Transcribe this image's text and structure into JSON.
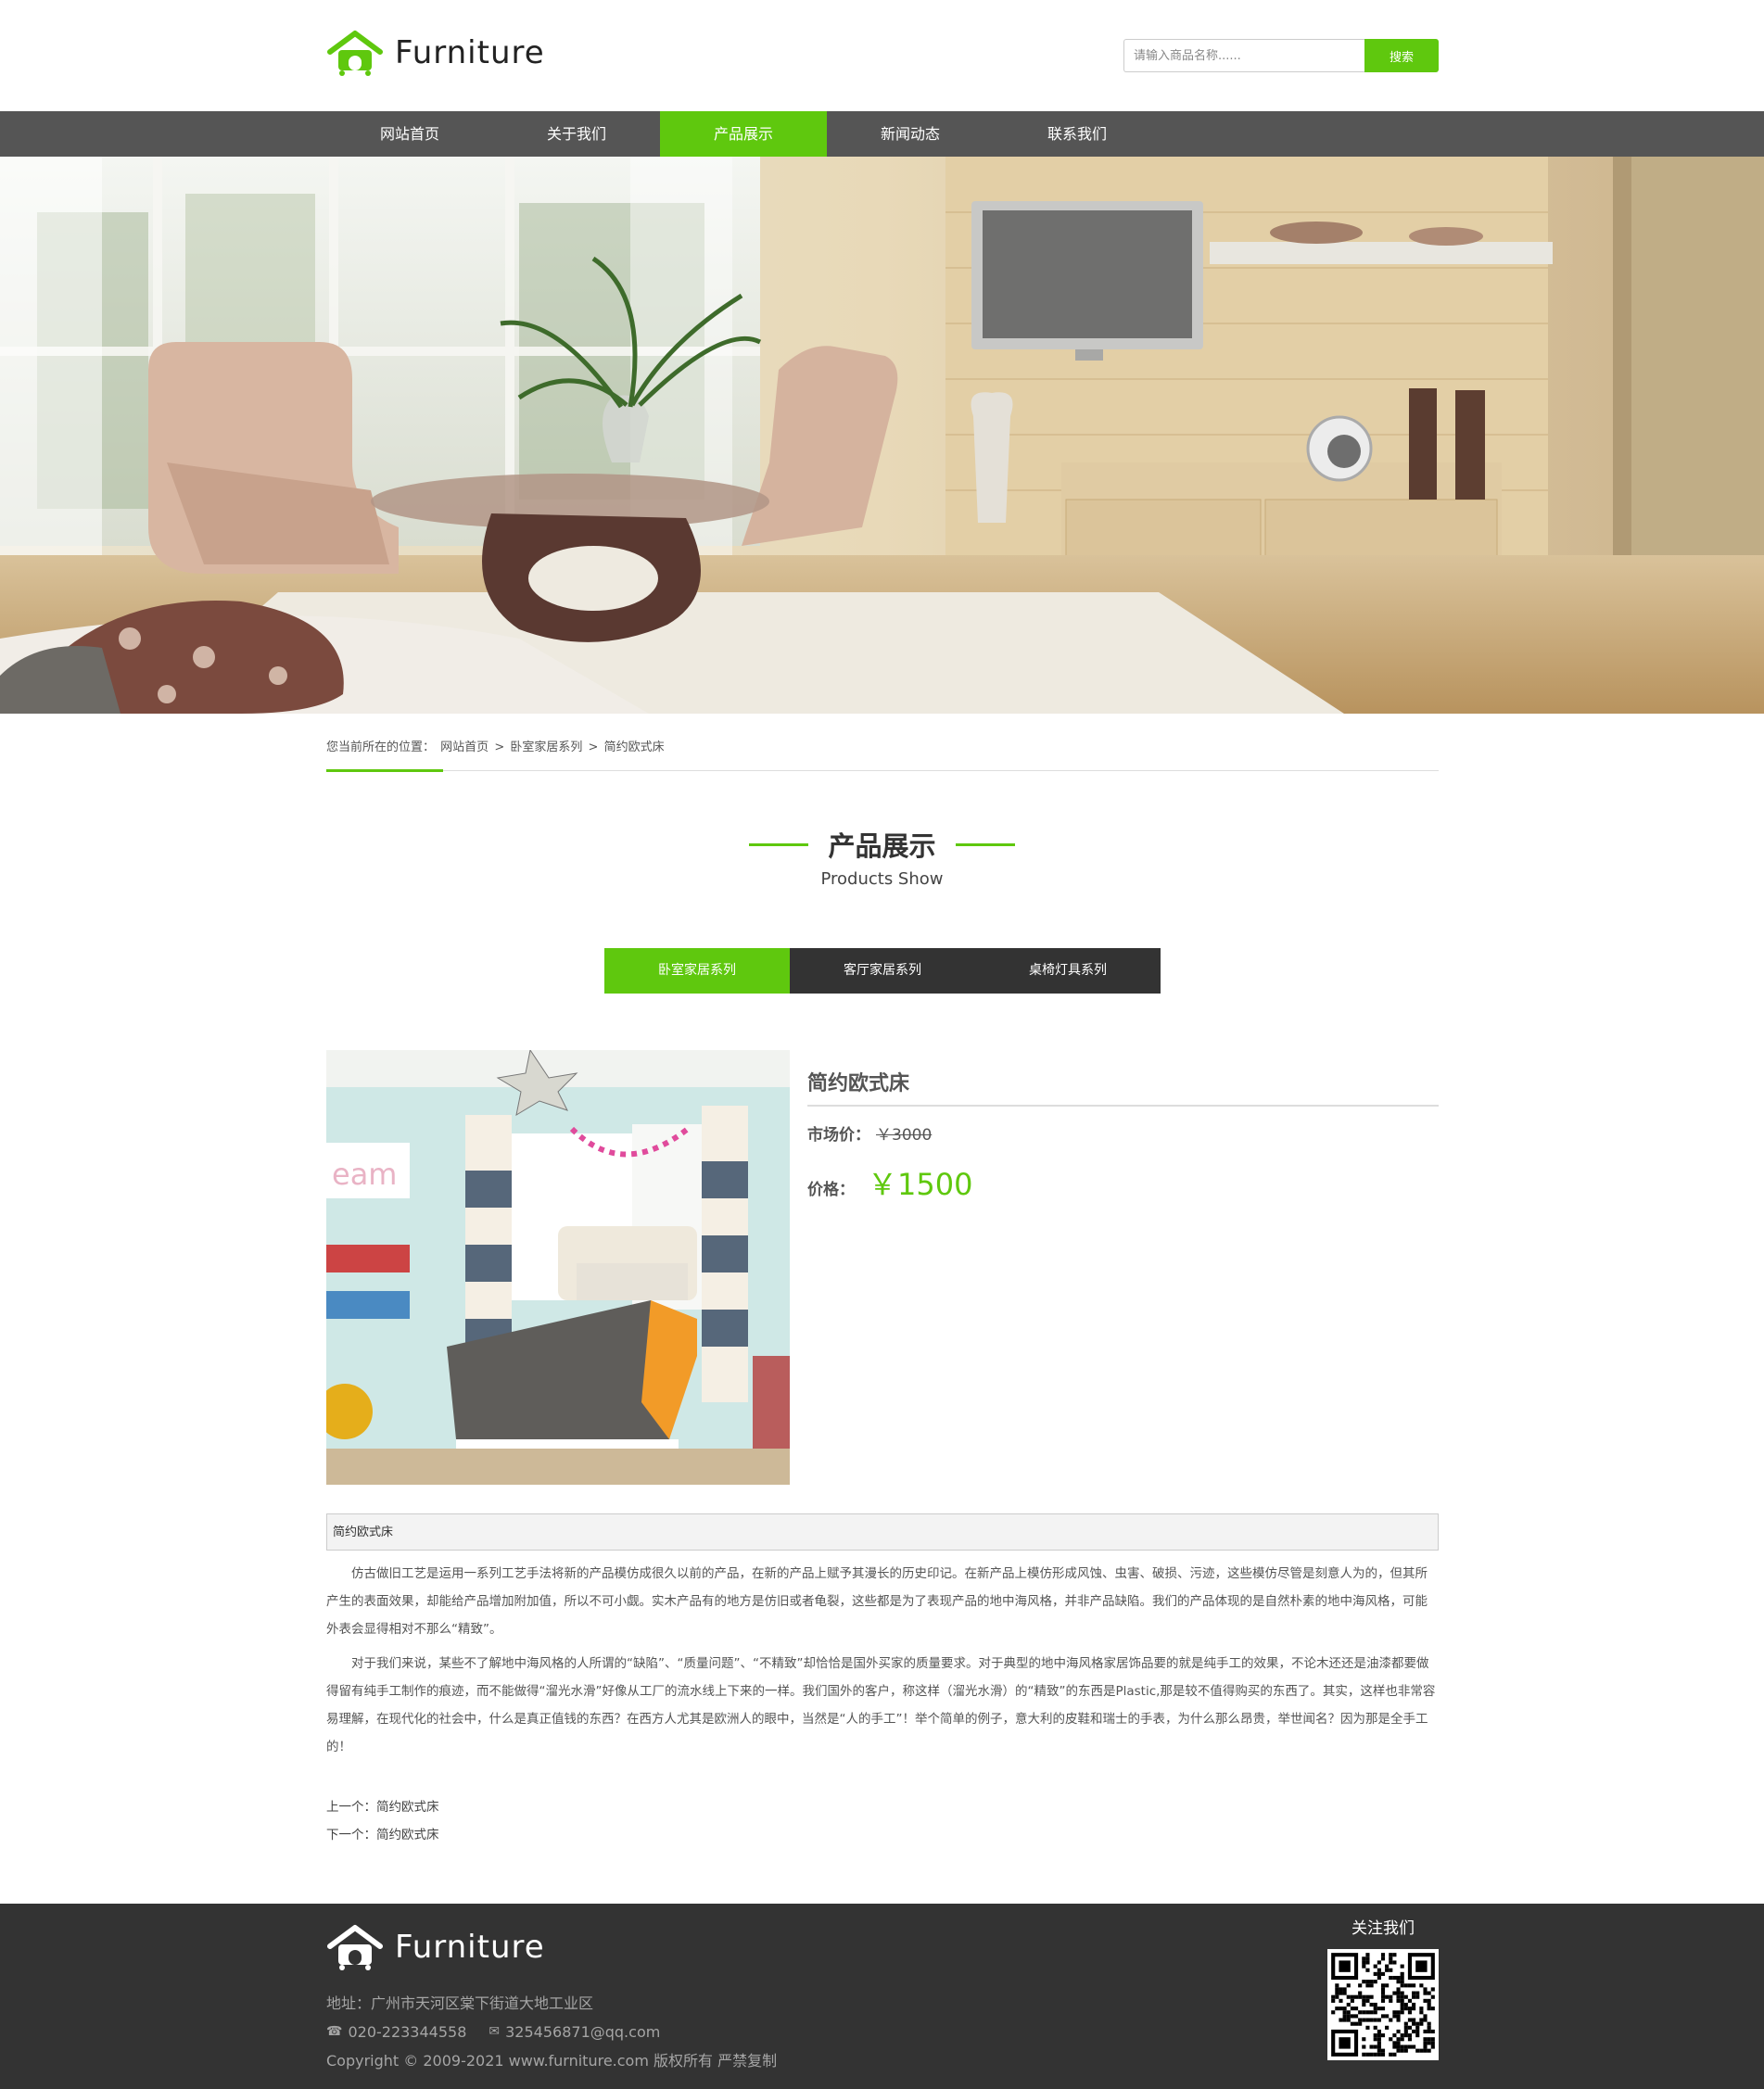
{
  "header": {
    "logo_text": "Furniture",
    "search_placeholder": "请输入商品名称......",
    "search_button": "搜索"
  },
  "nav": {
    "items": [
      "网站首页",
      "关于我们",
      "产品展示",
      "新闻动态",
      "联系我们"
    ],
    "active": "产品展示"
  },
  "breadcrumb": {
    "prefix": "您当前所在的位置：",
    "home": "网站首页",
    "sep1": ">",
    "category": "卧室家居系列",
    "sep2": ">",
    "current": "简约欧式床"
  },
  "section": {
    "title_cn": "产品展示",
    "title_en": "Products Show"
  },
  "tabs": [
    "卧室家居系列",
    "客厅家居系列",
    "桌椅灯具系列"
  ],
  "product": {
    "name": "简约欧式床",
    "market_label": "市场价：",
    "market_price": "￥3000",
    "price_label": "价格：",
    "price": "￥1500"
  },
  "description": {
    "header": "简约欧式床",
    "p1": "仿古做旧工艺是运用一系列工艺手法将新的产品模仿成很久以前的产品，在新的产品上赋予其漫长的历史印记。在新产品上模仿形成风蚀、虫害、破损、污迹，这些模仿尽管是刻意人为的，但其所产生的表面效果，却能给产品增加附加值，所以不可小觑。实木产品有的地方是仿旧或者龟裂，这些都是为了表现产品的地中海风格，并非产品缺陷。我们的产品体现的是自然朴素的地中海风格，可能外表会显得相对不那么“精致”。",
    "p2": "对于我们来说，某些不了解地中海风格的人所谓的“缺陷”、“质量问题”、“不精致”却恰恰是国外买家的质量要求。对于典型的地中海风格家居饰品要的就是纯手工的效果，不论木还还是油漆都要做得留有纯手工制作的痕迹，而不能做得“溜光水滑”好像从工厂的流水线上下来的一样。我们国外的客户，称这样（溜光水滑）的“精致”的东西是Plastic,那是较不值得购买的东西了。其实，这样也非常容易理解，在现代化的社会中，什么是真正值钱的东西？在西方人尤其是欧洲人的眼中，当然是“人的手工”！举个简单的例子，意大利的皮鞋和瑞士的手表，为什么那么昂贵，举世闻名？因为那是全手工的！"
  },
  "pager": {
    "prev_label": "上一个：",
    "prev_title": "简约欧式床",
    "next_label": "下一个：",
    "next_title": "简约欧式床"
  },
  "footer": {
    "logo_text": "Furniture",
    "address": "地址：广州市天河区棠下街道大地工业区",
    "phone": "020-223344558",
    "email": "325456871@qq.com",
    "copyright": "Copyright © 2009-2021 www.furniture.com 版权所有 严禁复制",
    "follow": "关注我们"
  },
  "colors": {
    "accent": "#5fc80e",
    "nav_bg": "#555555",
    "tab_bg": "#333333",
    "footer_bg": "#333333"
  },
  "icons": [
    "house-logo-icon",
    "phone-icon",
    "mail-icon",
    "qr-code"
  ]
}
